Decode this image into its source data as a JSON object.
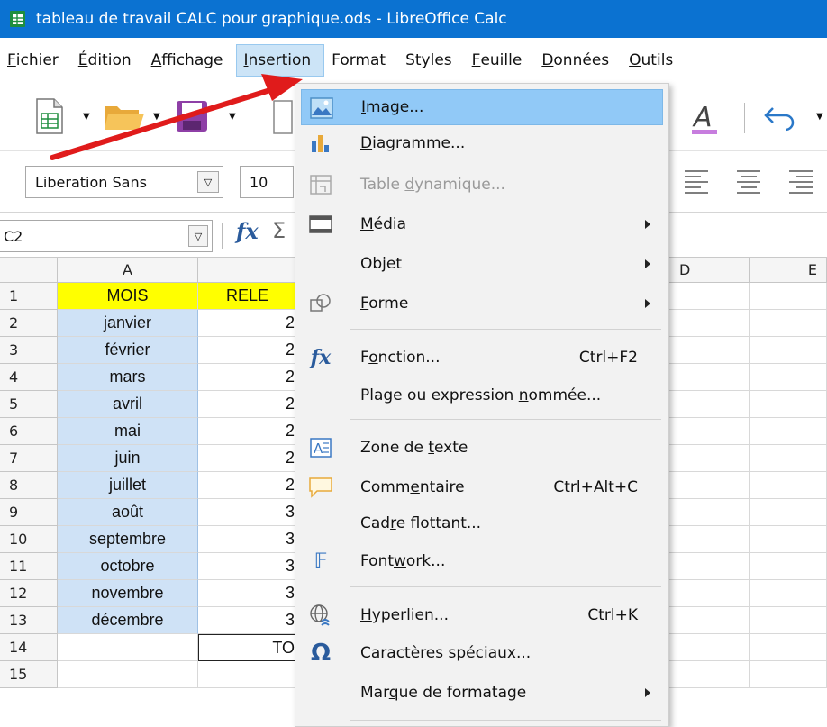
{
  "window": {
    "title": "tableau de travail CALC pour graphique.ods - LibreOffice Calc"
  },
  "menubar": [
    {
      "label": "Fichier",
      "mn": "F",
      "rest": "ichier"
    },
    {
      "label": "Édition",
      "mn": "É",
      "rest": "dition"
    },
    {
      "label": "Affichage",
      "mn": "A",
      "rest": "ffichage"
    },
    {
      "label": "Insertion",
      "mn": "I",
      "rest": "nsertion"
    },
    {
      "label": "Format",
      "mn": "",
      "rest": "Format"
    },
    {
      "label": "Styles",
      "mn": "",
      "rest": "Styles"
    },
    {
      "label": "Feuille",
      "mn": "F",
      "rest": "euille"
    },
    {
      "label": "Données",
      "mn": "D",
      "rest": "onnées"
    },
    {
      "label": "Outils",
      "mn": "O",
      "rest": "utils"
    }
  ],
  "toolbar": {
    "font_name": "Liberation Sans",
    "font_size": "10"
  },
  "formula": {
    "cell_ref": "C2",
    "fx": "fx",
    "sigma": "Σ"
  },
  "sheet": {
    "columns": [
      "A",
      "D",
      "E"
    ],
    "rows": [
      "1",
      "2",
      "3",
      "4",
      "5",
      "6",
      "7",
      "8",
      "9",
      "10",
      "11",
      "12",
      "13",
      "14",
      "15"
    ],
    "colA": [
      "MOIS",
      "janvier",
      "février",
      "mars",
      "avril",
      "mai",
      "juin",
      "juillet",
      "août",
      "septembre",
      "octobre",
      "novembre",
      "décembre",
      "",
      ""
    ],
    "colB": [
      "RELE",
      "2",
      "2",
      "2",
      "2",
      "2",
      "2",
      "2",
      "3",
      "3",
      "3",
      "3",
      "3",
      "TO",
      ""
    ]
  },
  "menu": {
    "image": {
      "a": "I",
      "b": "mage..."
    },
    "diagramme": {
      "a": "D",
      "b": "iagramme..."
    },
    "table": {
      "a": "Table ",
      "u": "d",
      "b": "ynamique..."
    },
    "media": {
      "a": "M",
      "b": "édia"
    },
    "objet": {
      "a": "Ob",
      "u": "j",
      "b": "et"
    },
    "forme": {
      "a": "F",
      "b": "orme"
    },
    "fonction": {
      "a": "F",
      "u": "o",
      "b": "nction...",
      "shortcut": "Ctrl+F2"
    },
    "plage": {
      "a": "Plage ou expression ",
      "u": "n",
      "b": "ommée..."
    },
    "zone": {
      "a": "Zone de ",
      "u": "t",
      "b": "exte"
    },
    "commentaire": {
      "a": "Comm",
      "u": "e",
      "b": "ntaire",
      "shortcut": "Ctrl+Alt+C"
    },
    "cadre": {
      "a": "Cad",
      "u": "r",
      "b": "e flottant..."
    },
    "fontwork": {
      "a": "Font",
      "u": "w",
      "b": "ork..."
    },
    "hyperlien": {
      "a": "H",
      "b": "yperlien...",
      "shortcut": "Ctrl+K"
    },
    "caracteres": {
      "a": "Caractères ",
      "u": "s",
      "b": "péciaux..."
    },
    "marque": {
      "a": "Mar",
      "u": "q",
      "b": "ue de formatage"
    }
  },
  "colors": {
    "titlebar": "#0b72d1",
    "menu_highlight": "#91c9f7",
    "header_yellow": "#ffff00",
    "selection": "#cfe2f6",
    "arrow": "#e01b1b"
  }
}
